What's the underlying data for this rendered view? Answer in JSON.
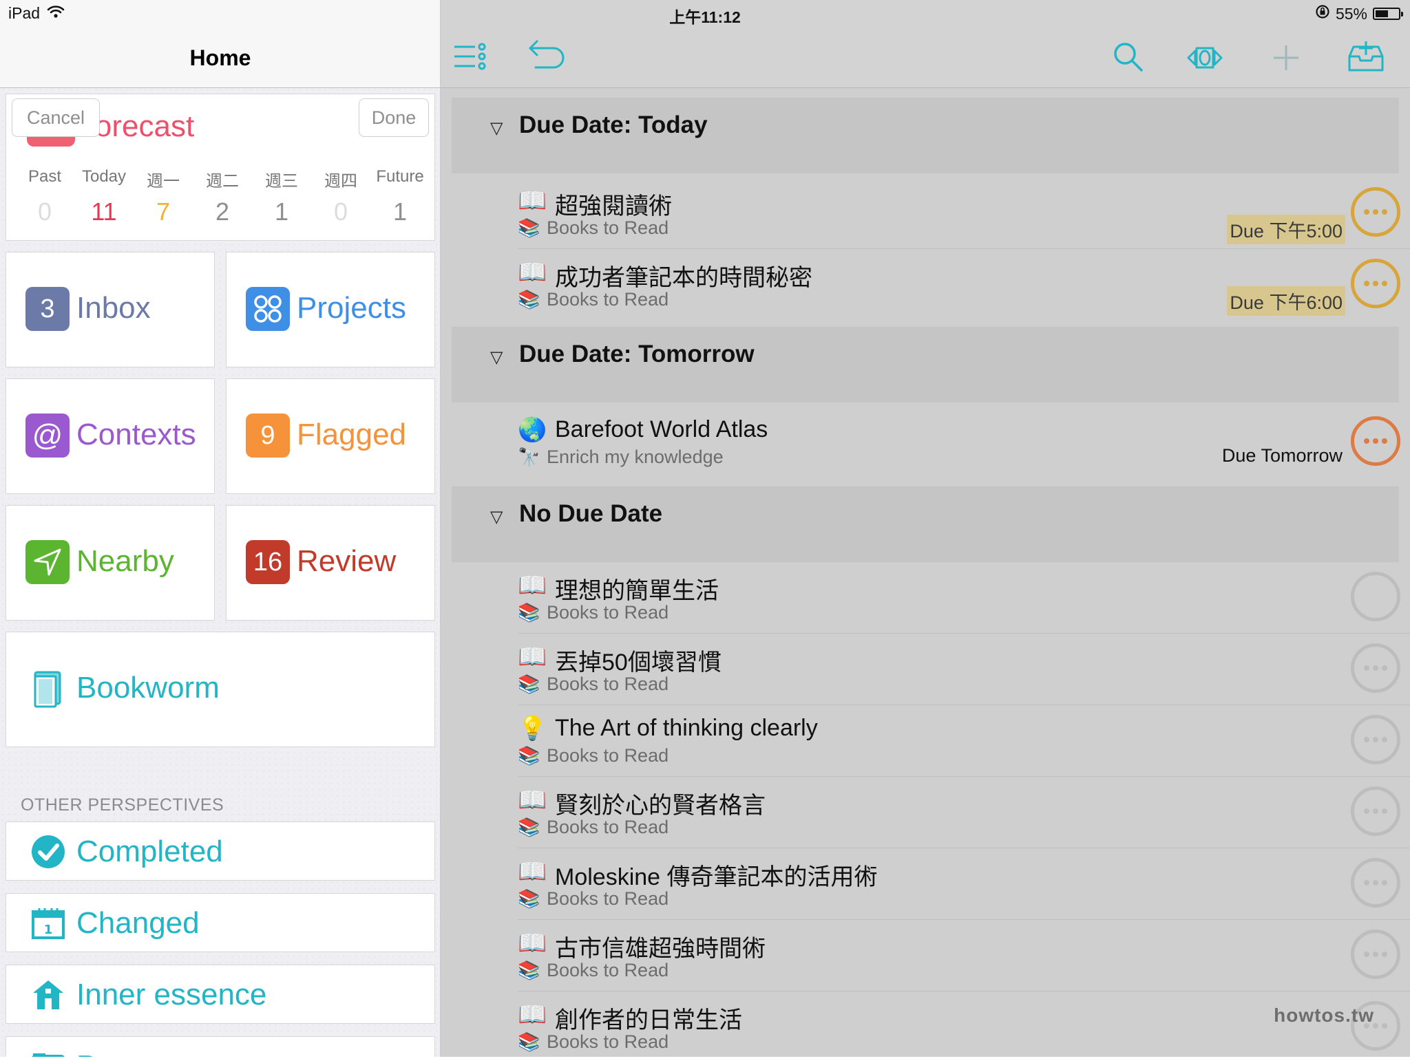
{
  "status_bar": {
    "device": "iPad",
    "time": "上午11:12",
    "battery": "55%",
    "battery_level": 0.55
  },
  "sidebar": {
    "title": "Home",
    "forecast": {
      "title": "Forecast",
      "cancel_label": "Cancel",
      "done_label": "Done",
      "days": [
        "Past",
        "Today",
        "週一",
        "週二",
        "週三",
        "週四",
        "Future"
      ],
      "counts": [
        "0",
        "11",
        "7",
        "2",
        "1",
        "0",
        "1"
      ]
    },
    "tiles": {
      "inbox": {
        "badge": "3",
        "label": "Inbox"
      },
      "projects": {
        "label": "Projects"
      },
      "contexts": {
        "label": "Contexts"
      },
      "flagged": {
        "badge": "9",
        "label": "Flagged"
      },
      "nearby": {
        "label": "Nearby"
      },
      "review": {
        "badge": "16",
        "label": "Review"
      },
      "bookworm": {
        "label": "Bookworm"
      }
    },
    "other_header": "OTHER PERSPECTIVES",
    "perspectives": [
      "Completed",
      "Changed",
      "Inner essence",
      "Person"
    ]
  },
  "colors": {
    "forecast": "#ef4f6a",
    "inbox": "#6b7aa6",
    "projects": "#3f8fe6",
    "contexts": "#9b59d0",
    "flagged": "#f5923a",
    "nearby": "#5cb531",
    "review": "#c23b2a",
    "teal": "#21b5c6",
    "due_highlight": "#d7c68e",
    "check_yellow": "#d8a53a",
    "check_orange": "#dd7b45"
  },
  "toolbar": {
    "icons": [
      "perspectives-menu-icon",
      "undo-icon",
      "search-icon",
      "view-options-icon",
      "add-icon",
      "inbox-add-icon"
    ]
  },
  "groups": [
    {
      "title": "Due Date: Today"
    },
    {
      "title": "Due Date: Tomorrow"
    },
    {
      "title": "No Due Date"
    }
  ],
  "tasks": [
    {
      "emoji": "📖",
      "name": "超強閱讀術",
      "project_emoji": "📚",
      "project": "Books to Read",
      "due": "Due 下午5:00",
      "check": "yellow"
    },
    {
      "emoji": "📖",
      "name": "成功者筆記本的時間秘密",
      "project_emoji": "📚",
      "project": "Books to Read",
      "due": "Due 下午6:00",
      "check": "yellow"
    },
    {
      "emoji": "🌏",
      "name": "Barefoot World Atlas",
      "project_emoji": "🔭",
      "project": "Enrich my knowledge",
      "due": "Due Tomorrow",
      "check": "orange"
    },
    {
      "emoji": "📖",
      "name": "理想的簡單生活",
      "project_emoji": "📚",
      "project": "Books to Read",
      "due": "",
      "check": "empty"
    },
    {
      "emoji": "📖",
      "name": "丟掉50個壞習慣",
      "project_emoji": "📚",
      "project": "Books to Read",
      "due": "",
      "check": "gray"
    },
    {
      "emoji": "💡",
      "name": "The Art of thinking clearly",
      "project_emoji": "📚",
      "project": "Books to Read",
      "due": "",
      "check": "gray"
    },
    {
      "emoji": "📖",
      "name": "賢刻於心的賢者格言",
      "project_emoji": "📚",
      "project": "Books to Read",
      "due": "",
      "check": "gray"
    },
    {
      "emoji": "📖",
      "name": " Moleskine 傳奇筆記本的活用術",
      "project_emoji": "📚",
      "project": "Books to Read",
      "due": "",
      "check": "gray"
    },
    {
      "emoji": "📖",
      "name": "古市信雄超強時間術",
      "project_emoji": "📚",
      "project": "Books to Read",
      "due": "",
      "check": "gray"
    },
    {
      "emoji": "📖",
      "name": "創作者的日常生活",
      "project_emoji": "📚",
      "project": "Books to Read",
      "due": "",
      "check": "gray"
    }
  ],
  "watermark": "howtos.tw"
}
